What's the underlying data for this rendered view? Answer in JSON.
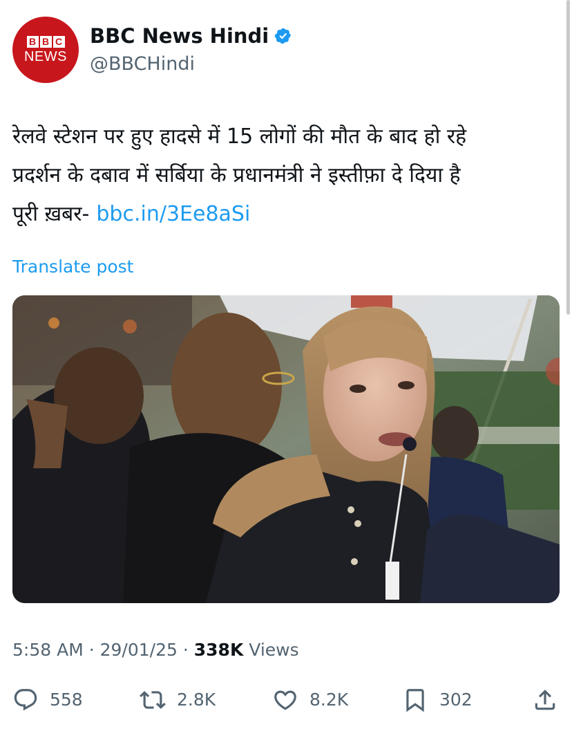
{
  "author": {
    "avatar_blocks": [
      "B",
      "B",
      "C"
    ],
    "avatar_word": "NEWS",
    "display_name": "BBC News Hindi",
    "handle": "@BBCHindi",
    "verified_icon": "verified-badge-icon"
  },
  "tweet": {
    "lines": [
      "रेलवे स्टेशन पर हुए हादसे में 15 लोगों की मौत के बाद हो रहे",
      "प्रदर्शन के दबाव में सर्बिया के प्रधानमंत्री ने इस्तीफ़ा दे दिया है"
    ],
    "link_prefix": "पूरी ख़बर-",
    "link_text": "bbc.in/3Ee8aSi",
    "translate_label": "Translate post"
  },
  "meta": {
    "time": "5:58 AM",
    "date": "29/01/25",
    "separator": "·",
    "views_count": "338K",
    "views_label": "Views"
  },
  "actions": {
    "replies": "558",
    "reposts": "2.8K",
    "likes": "8.2K",
    "bookmarks": "302"
  },
  "colors": {
    "accent": "#1d9bf0",
    "secondary_text": "#536471",
    "brand_red": "#c8161d"
  }
}
